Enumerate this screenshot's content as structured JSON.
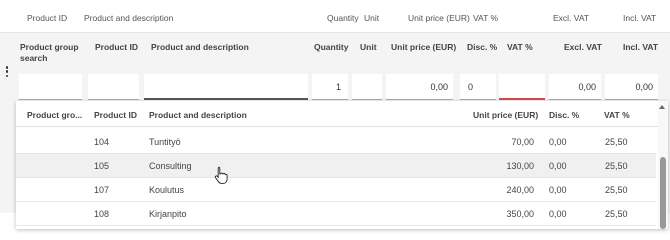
{
  "background_header": {
    "product_id": "Product ID",
    "product_desc": "Product and description",
    "quantity": "Quantity",
    "unit": "Unit",
    "unit_price": "Unit price (EUR)",
    "vat": "VAT %",
    "excl_vat": "Excl. VAT",
    "incl_vat": "Incl. VAT"
  },
  "form_header": {
    "product_group_line1": "Product group",
    "product_group_line2": "search",
    "product_id": "Product ID",
    "product_desc": "Product and description",
    "quantity": "Quantity",
    "unit": "Unit",
    "unit_price": "Unit price (EUR)",
    "disc": "Disc. %",
    "vat": "VAT %",
    "excl_vat": "Excl. VAT",
    "incl_vat": "Incl. VAT"
  },
  "input_row": {
    "product_group": "",
    "product_id": "",
    "product_desc": "",
    "quantity": "1",
    "unit": "",
    "unit_price": "0,00",
    "disc": "0",
    "vat": "",
    "excl_vat": "0,00",
    "incl_vat": "0,00"
  },
  "dropdown": {
    "columns": {
      "product_group": "Product gro...",
      "product_id": "Product ID",
      "product_desc": "Product and description",
      "unit_price": "Unit price (EUR)",
      "disc": "Disc. %",
      "vat": "VAT %"
    },
    "rows": [
      {
        "product_id": "104",
        "description": "Tuntityö",
        "unit_price": "70,00",
        "disc": "0,00",
        "vat": "25,50"
      },
      {
        "product_id": "105",
        "description": "Consulting",
        "unit_price": "130,00",
        "disc": "0,00",
        "vat": "25,50"
      },
      {
        "product_id": "107",
        "description": "Koulutus",
        "unit_price": "240,00",
        "disc": "0,00",
        "vat": "25,50"
      },
      {
        "product_id": "108",
        "description": "Kirjanpito",
        "unit_price": "350,00",
        "disc": "0,00",
        "vat": "25,50"
      }
    ]
  },
  "icons": {
    "row_menu": "kebab-menu-icon",
    "scroll_up": "caret-up-icon",
    "cursor": "hand-pointer-icon"
  },
  "colors": {
    "error_underline": "#d24b4b",
    "row_hover": "#f0f0f0",
    "panel_bg": "#f4f4f4"
  }
}
